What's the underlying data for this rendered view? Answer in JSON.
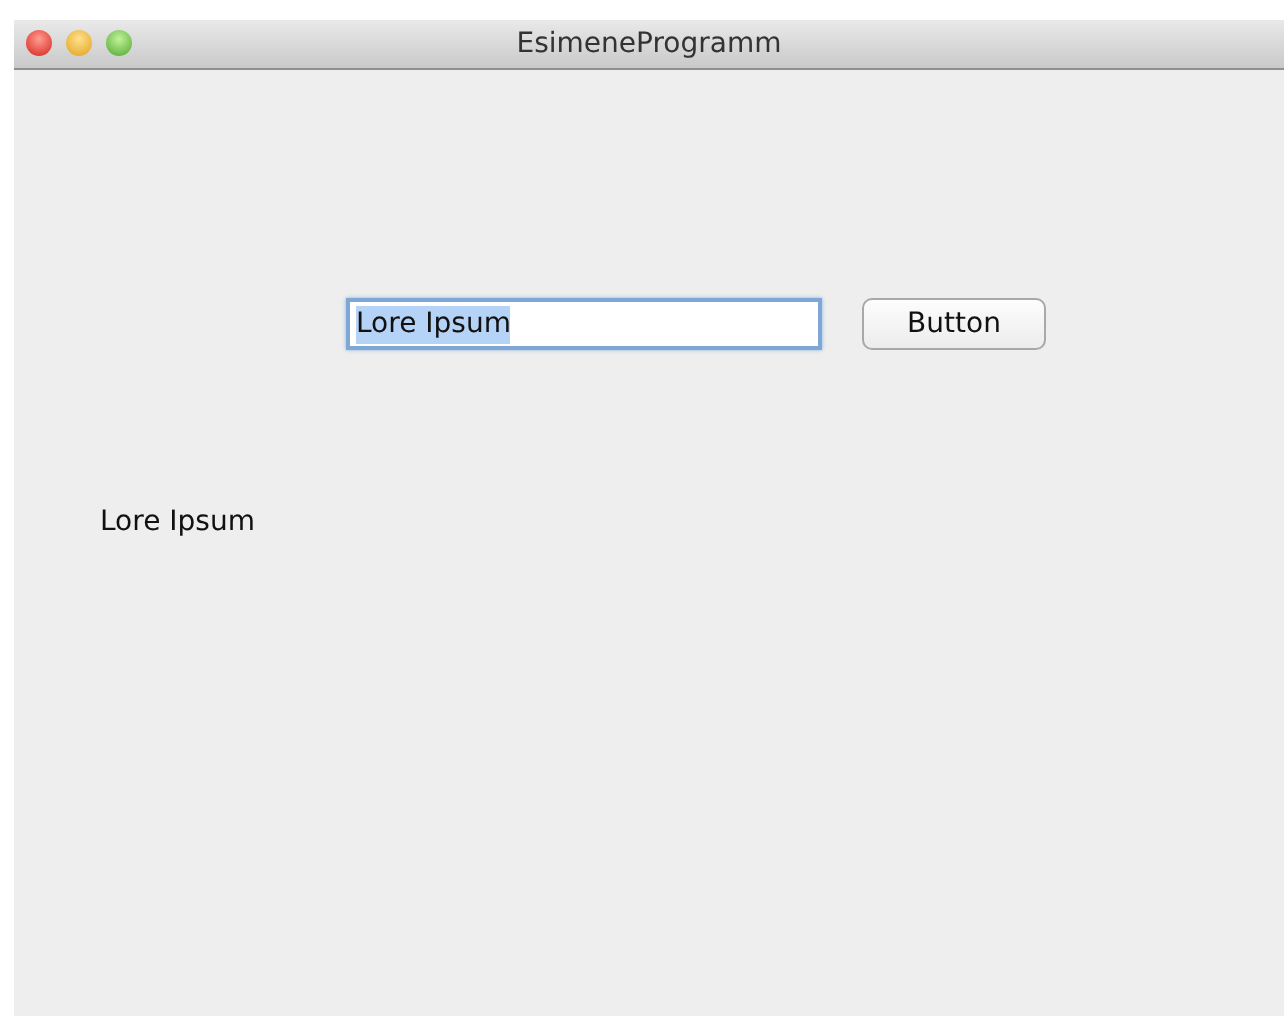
{
  "window": {
    "title": "EsimeneProgramm"
  },
  "text_field": {
    "value": "Lore Ipsum",
    "text_selected": true,
    "focused": true
  },
  "button": {
    "label": "Button"
  },
  "label": "Lore Ipsum"
}
